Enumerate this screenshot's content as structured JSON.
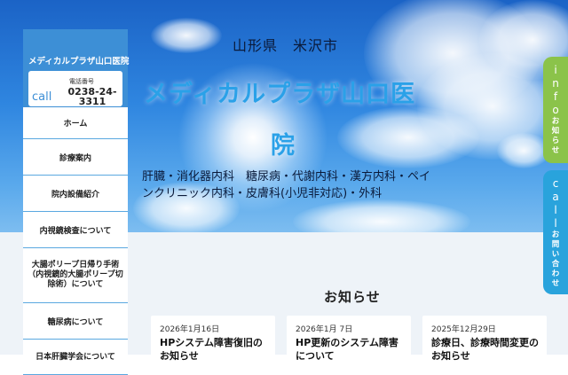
{
  "hero": {
    "prefecture": "山形県　米沢市",
    "title_line1": "メディカルプラザ山口医",
    "title_line2": "院",
    "departments": "肝臓・消化器内科　糖尿病・代謝内科・漢方内科・ペインクリニック内科・皮膚科(小児非対応)・外科"
  },
  "sidebar": {
    "clinic_name": "メディカルプラザ山口医院",
    "call_word": "call",
    "tel_label": "電話番号",
    "tel": "0238-24-3311",
    "nav": [
      {
        "label": "ホーム"
      },
      {
        "label": "診療案内"
      },
      {
        "label": "院内設備紹介"
      },
      {
        "label": "内視鏡検査について"
      },
      {
        "label": "大腸ポリープ日帰り手術（内視鏡的大腸ポリープ切除術）について"
      },
      {
        "label": "糖尿病について"
      },
      {
        "label": "日本肝臓学会について"
      }
    ]
  },
  "news": {
    "heading": "お知らせ",
    "items": [
      {
        "date": "2026年1月16日",
        "title": "HPシステム障害復旧のお知らせ"
      },
      {
        "date": "2026年1月 7日",
        "title": "HP更新のシステム障害について"
      },
      {
        "date": "2025年12月29日",
        "title": "診療日、診療時間変更のお知らせ"
      }
    ]
  },
  "side_tabs": {
    "info_en": "info",
    "info_jp": "お知らせ",
    "call_en": "call",
    "call_jp": "お問い合わせ"
  },
  "colors": {
    "sidebar_blue": "#3d8fd6",
    "info_tab": "#8bc34a",
    "call_tab": "#29a3dc",
    "title_blue": "#2aa1e8"
  }
}
